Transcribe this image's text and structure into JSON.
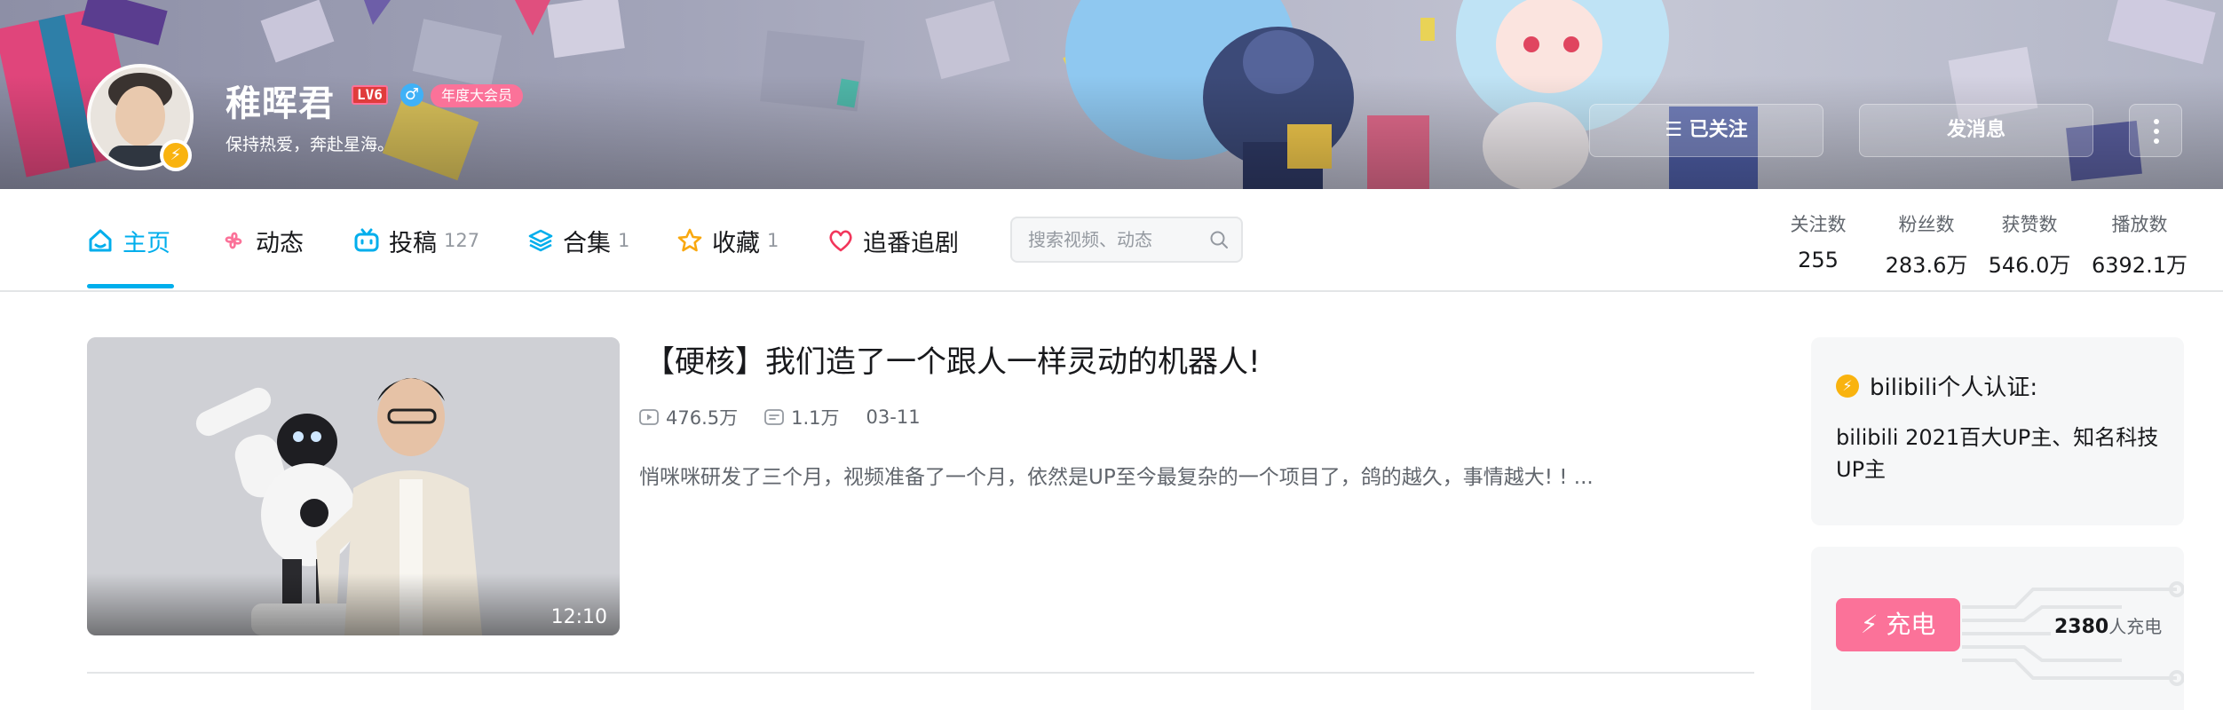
{
  "profile": {
    "name": "稚晖君",
    "level": "LV6",
    "gender_symbol": "♂",
    "vip_label": "年度大会员",
    "signature": "保持热爱，奔赴星海。",
    "avatar_badge": "⚡"
  },
  "actions": {
    "follow_label": "☰ 已关注",
    "message_label": "发消息"
  },
  "nav": {
    "tabs": [
      {
        "label": "主页",
        "count": "",
        "icon": "home-icon"
      },
      {
        "label": "动态",
        "count": "",
        "icon": "pinwheel-icon"
      },
      {
        "label": "投稿",
        "count": "127",
        "icon": "tv-icon"
      },
      {
        "label": "合集",
        "count": "1",
        "icon": "layers-icon"
      },
      {
        "label": "收藏",
        "count": "1",
        "icon": "star-icon"
      },
      {
        "label": "追番追剧",
        "count": "",
        "icon": "heart-icon"
      }
    ],
    "search_placeholder": "搜索视频、动态"
  },
  "stats": [
    {
      "label": "关注数",
      "value": "255"
    },
    {
      "label": "粉丝数",
      "value": "283.6万"
    },
    {
      "label": "获赞数",
      "value": "546.0万"
    },
    {
      "label": "播放数",
      "value": "6392.1万"
    }
  ],
  "video": {
    "title": "【硬核】我们造了一个跟人一样灵动的机器人!",
    "plays": "476.5万",
    "danmaku": "1.1万",
    "date": "03-11",
    "description": "悄咪咪研发了三个月，视频准备了一个月，依然是UP至今最复杂的一个项目了，鸽的越久，事情越大! ! ...",
    "duration": "12:10"
  },
  "certification": {
    "heading": "bilibili个人认证:",
    "text": "bilibili 2021百大UP主、知名科技UP主"
  },
  "charge": {
    "button_label": "充电",
    "count": "2380",
    "count_suffix": "人充电"
  },
  "colors": {
    "accent": "#00aeec",
    "pink": "#fb7299",
    "gold": "#f9b30f"
  }
}
